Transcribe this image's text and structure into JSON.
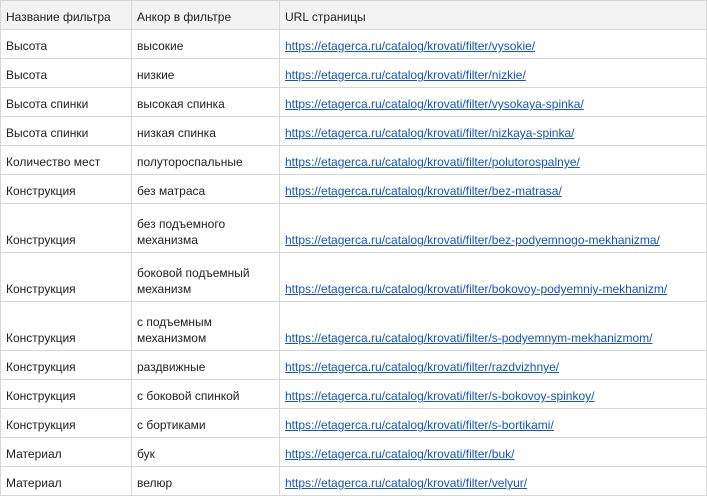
{
  "columns": [
    "Название фильтра",
    "Анкор в фильтре",
    "URL страницы"
  ],
  "rows": [
    {
      "filter": "Высота",
      "anchor": "высокие",
      "url": "https://etagerca.ru/catalog/krovati/filter/vysokie/"
    },
    {
      "filter": "Высота",
      "anchor": "низкие",
      "url": "https://etagerca.ru/catalog/krovati/filter/nizkie/"
    },
    {
      "filter": "Высота спинки",
      "anchor": "высокая спинка",
      "url": "https://etagerca.ru/catalog/krovati/filter/vysokaya-spinka/"
    },
    {
      "filter": "Высота спинки",
      "anchor": "низкая спинка",
      "url": "https://etagerca.ru/catalog/krovati/filter/nizkaya-spinka/"
    },
    {
      "filter": "Количество мест",
      "anchor": "полутороспальные",
      "url": "https://etagerca.ru/catalog/krovati/filter/polutorospalnye/"
    },
    {
      "filter": "Конструкция",
      "anchor": "без матраса",
      "url": "https://etagerca.ru/catalog/krovati/filter/bez-matrasa/"
    },
    {
      "filter": "Конструкция",
      "anchor": "без подъемного механизма",
      "url": "https://etagerca.ru/catalog/krovati/filter/bez-podyemnogo-mekhanizma/"
    },
    {
      "filter": "Конструкция",
      "anchor": "боковой подъемный механизм",
      "url": "https://etagerca.ru/catalog/krovati/filter/bokovoy-podyemniy-mekhanizm/"
    },
    {
      "filter": "Конструкция",
      "anchor": "с подъемным механизмом",
      "url": "https://etagerca.ru/catalog/krovati/filter/s-podyemnym-mekhanizmom/"
    },
    {
      "filter": "Конструкция",
      "anchor": "раздвижные",
      "url": "https://etagerca.ru/catalog/krovati/filter/razdvizhnye/"
    },
    {
      "filter": "Конструкция",
      "anchor": "с боковой спинкой",
      "url": "https://etagerca.ru/catalog/krovati/filter/s-bokovoy-spinkoy/"
    },
    {
      "filter": "Конструкция",
      "anchor": "с бортиками",
      "url": "https://etagerca.ru/catalog/krovati/filter/s-bortikami/"
    },
    {
      "filter": "Материал",
      "anchor": "бук",
      "url": "https://etagerca.ru/catalog/krovati/filter/buk/"
    },
    {
      "filter": "Материал",
      "anchor": "велюр",
      "url": "https://etagerca.ru/catalog/krovati/filter/velyur/"
    }
  ],
  "colors": {
    "header_bg": "#f3f3f3",
    "grid": "#d7d7d7",
    "link": "#1155cc",
    "text": "#202124"
  }
}
